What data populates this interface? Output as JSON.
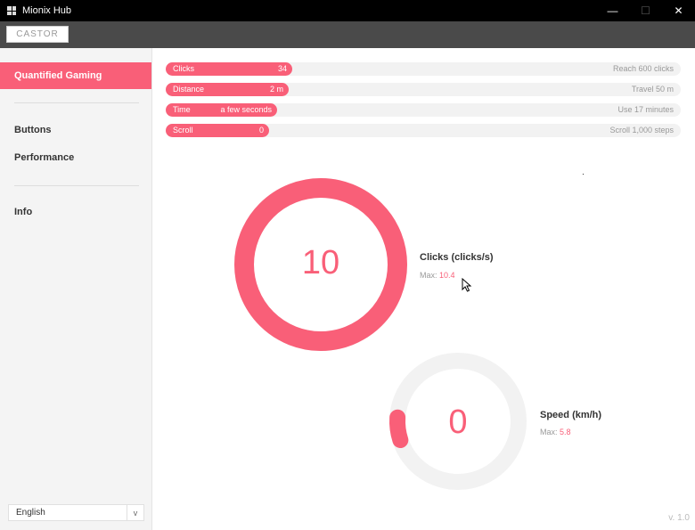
{
  "window": {
    "title": "Mionix Hub",
    "minimize_glyph": "—",
    "maximize_glyph": "☐",
    "close_glyph": "✕"
  },
  "device": {
    "name": "CASTOR"
  },
  "sidebar": {
    "items": [
      {
        "label": "Quantified Gaming",
        "active": true
      },
      {
        "label": "Buttons",
        "active": false
      },
      {
        "label": "Performance",
        "active": false
      },
      {
        "label": "Info",
        "active": false
      }
    ],
    "language": "English",
    "language_chevron": "v"
  },
  "progress": [
    {
      "label": "Clicks",
      "value": "34",
      "goal": "Reach 600 clicks",
      "fraction": 0.057
    },
    {
      "label": "Distance",
      "value": "2 m",
      "goal": "Travel 50 m",
      "fraction": 0.04
    },
    {
      "label": "Time",
      "value": "a few seconds",
      "goal": "Use 17 minutes",
      "fraction": 0.01
    },
    {
      "label": "Scroll",
      "value": "0",
      "goal": "Scroll 1,000 steps",
      "fraction": 0
    }
  ],
  "gauges": {
    "clicks": {
      "value": "10",
      "title": "Clicks (clicks/s)",
      "max_label": "Max:",
      "max_value": "10.4",
      "fill_fraction": 1.0
    },
    "speed": {
      "value": "0",
      "title": "Speed (km/h)",
      "max_label": "Max:",
      "max_value": "5.8",
      "fill_fraction": 0.06
    }
  },
  "footer": {
    "version": "v. 1.0"
  },
  "colors": {
    "accent": "#f95f78",
    "track": "#f2f2f2",
    "titlebar": "#000000",
    "devicebar": "#4a4a4a",
    "sidebar": "#f4f4f4"
  },
  "icons": [
    "app-logo-icon",
    "minimize-icon",
    "maximize-icon",
    "close-icon",
    "chevron-down-icon",
    "mouse-cursor-icon"
  ]
}
